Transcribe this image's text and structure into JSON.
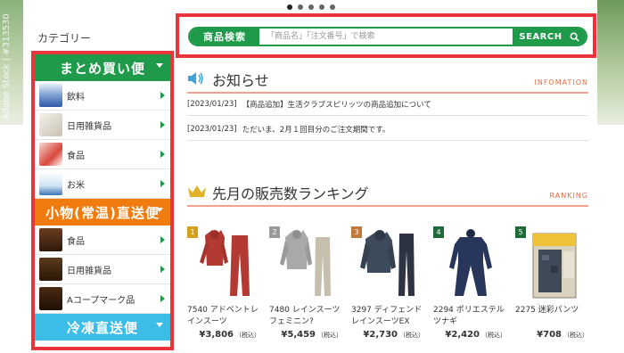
{
  "background": {
    "watermark": "Adobe Stock | #313530"
  },
  "slider": {
    "dot_count": 5,
    "active_index": 0
  },
  "sidebar": {
    "title": "カテゴリー",
    "sections": [
      {
        "label": "まとめ買い便",
        "color": "#1e9a4a",
        "items": [
          {
            "label": "飲料"
          },
          {
            "label": "日用雑貨品"
          },
          {
            "label": "食品"
          },
          {
            "label": "お米"
          }
        ]
      },
      {
        "label": "小物(常温)直送便",
        "color": "#f07b0e",
        "items": [
          {
            "label": "食品"
          },
          {
            "label": "日用雑貨品"
          },
          {
            "label": "Aコープマーク品"
          }
        ]
      },
      {
        "label": "冷凍直送便",
        "color": "#3bbde8",
        "items": []
      }
    ]
  },
  "search": {
    "label": "商品検索",
    "placeholder": "「商品名」「注文番号」で検索",
    "button_label": "SEARCH"
  },
  "news": {
    "title": "お知らせ",
    "subtitle": "INFOMATION",
    "items": [
      {
        "date": "[2023/01/23]",
        "text": "【商品追加】生活クラブスピリッツの商品追加について"
      },
      {
        "date": "[2023/01/23]",
        "text": "ただいま、2月１回目分のご注文期間です。"
      }
    ]
  },
  "ranking": {
    "title": "先月の販売数ランキング",
    "subtitle": "RANKING",
    "tax_label": "（税込）",
    "items": [
      {
        "rank": "1",
        "badge_color": "#d4a017",
        "name": "7540 アドベントレインスーツ",
        "price": "¥3,806"
      },
      {
        "rank": "2",
        "badge_color": "#9a9a9a",
        "name": "7480 レインスーツフェミニン?",
        "price": "¥5,459"
      },
      {
        "rank": "3",
        "badge_color": "#c0783c",
        "name": "3297 ディフェンドレインスーツEX",
        "price": "¥2,730"
      },
      {
        "rank": "4",
        "badge_color": "#1e6b3a",
        "name": "2294 ポリエステルツナギ",
        "price": "¥2,420"
      },
      {
        "rank": "5",
        "badge_color": "#1e6b3a",
        "name": "2275 迷彩パンツ",
        "price": "¥708"
      }
    ]
  },
  "colors": {
    "accent_green": "#1e9a4a",
    "highlight_red": "#e93539",
    "heading_rule": "#f3a08e"
  }
}
